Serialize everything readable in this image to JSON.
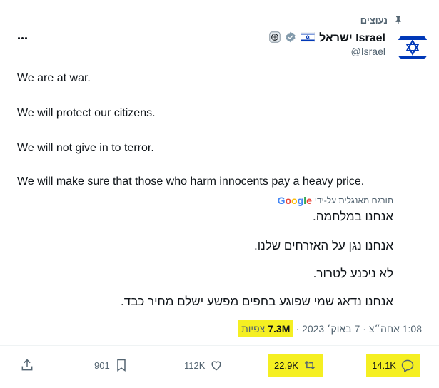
{
  "pinned": {
    "label": "נעוצים",
    "icon": "pin-icon"
  },
  "author": {
    "display_name": "Israel ישראל",
    "handle": "@Israel",
    "verified": true,
    "flag": "israel-flag",
    "affiliate_badge": "gov-badge",
    "avatar": "star-of-david-avatar"
  },
  "tweet": {
    "lines_en": [
      "We are at war.",
      "We will protect our citizens.",
      "We will not give in to terror.",
      "We will make sure that those who harm innocents pay a heavy price."
    ],
    "translated_label": "תורגם מאנגלית על-ידי",
    "translator": "Google",
    "lines_he": [
      "אנחנו במלחמה.",
      "אנחנו נגן על האזרחים שלנו.",
      "לא ניכנע לטרור.",
      "אנחנו נדאג שמי שפוגע בחפים מפשע ישלם מחיר כבד."
    ]
  },
  "meta": {
    "time": "1:08 אחה״צ",
    "date": "7 באוק׳ 2023",
    "views": "7.3M",
    "views_label": "צפיות",
    "separator": "·"
  },
  "actions": {
    "reply_count": "14.1K",
    "retweet_count": "22.9K",
    "like_count": "112K",
    "bookmark_count": "901"
  },
  "colors": {
    "text": "#0f1419",
    "muted": "#536471",
    "highlight": "#f5ef22",
    "verified": "#829aab",
    "israel_blue": "#0038b8"
  }
}
